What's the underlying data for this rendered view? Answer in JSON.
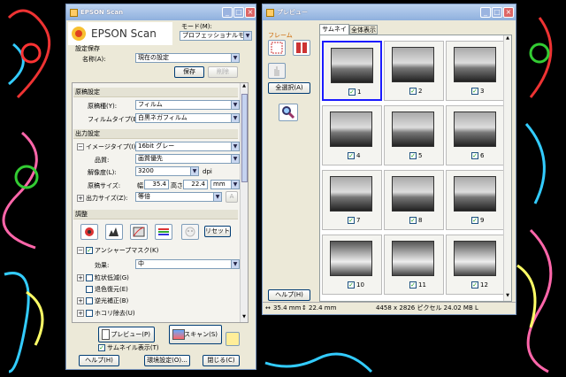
{
  "scan_window": {
    "title": "EPSON Scan",
    "logo_text": "EPSON Scan",
    "mode_label": "モード(M):",
    "mode_value": "プロフェッショナルモード",
    "preset_header": "設定保存",
    "name_label": "名称(A):",
    "name_value": "現在の設定",
    "save_button": "保存",
    "delete_button": "削除",
    "original_section": "原稿設定",
    "doc_type_label": "原稿種(Y):",
    "doc_type_value": "フィルム",
    "film_type_label": "フィルムタイプ(E):",
    "film_type_value": "白黒ネガフィルム",
    "output_section": "出力設定",
    "image_type_label": "イメージタイプ(I):",
    "image_type_value": "16bit グレー",
    "quality_label": "品質:",
    "quality_value": "画質優先",
    "resolution_label": "解像度(L):",
    "resolution_value": "3200",
    "resolution_unit": "dpi",
    "doc_size_label": "原稿サイズ:",
    "width_label": "幅",
    "width_value": "35.4",
    "height_label": "高さ",
    "height_value": "22.4",
    "size_unit": "mm",
    "output_size_label": "出力サイズ(Z):",
    "output_size_value": "等倍",
    "lock_glyph": "A",
    "adjust_section": "調整",
    "reset_button": "リセット",
    "unsharp_label": "アンシャープマスク(K)",
    "effect_label": "効果:",
    "effect_value": "中",
    "grain_label": "粒状低減(G)",
    "color_restore_label": "退色復元(E)",
    "backlight_label": "逆光補正(B)",
    "dust_label": "ホコリ除去(U)",
    "preview_button": "プレビュー(P)",
    "scan_button": "スキャン(S)",
    "thumbnail_label": "サムネイル表示(T)",
    "help_button": "ヘルプ(H)",
    "settings_button": "環境設定(O)...",
    "close_button": "閉じる(C)"
  },
  "preview_window": {
    "title": "プレビュー",
    "frame_label": "フレーム",
    "select_all_button": "全選択(A)",
    "help_button": "ヘルプ(H)",
    "tabs": [
      {
        "label": "サムネイル"
      },
      {
        "label": "全体表示"
      }
    ],
    "thumbnails": [
      {
        "num": "1"
      },
      {
        "num": "2"
      },
      {
        "num": "3"
      },
      {
        "num": "4"
      },
      {
        "num": "5"
      },
      {
        "num": "6"
      },
      {
        "num": "7"
      },
      {
        "num": "8"
      },
      {
        "num": "9"
      },
      {
        "num": "10"
      },
      {
        "num": "11"
      },
      {
        "num": "12"
      }
    ],
    "status": {
      "width": "35.4 mm",
      "height": "22.4 mm",
      "info": "4458 x 2826 ピクセル 24.02 MB",
      "mode": "L"
    }
  },
  "colors": {
    "title_bar": "#9bb4e0",
    "window_bg": "#ece9d8",
    "selection": "#1a1aff",
    "check": "#21a121"
  }
}
